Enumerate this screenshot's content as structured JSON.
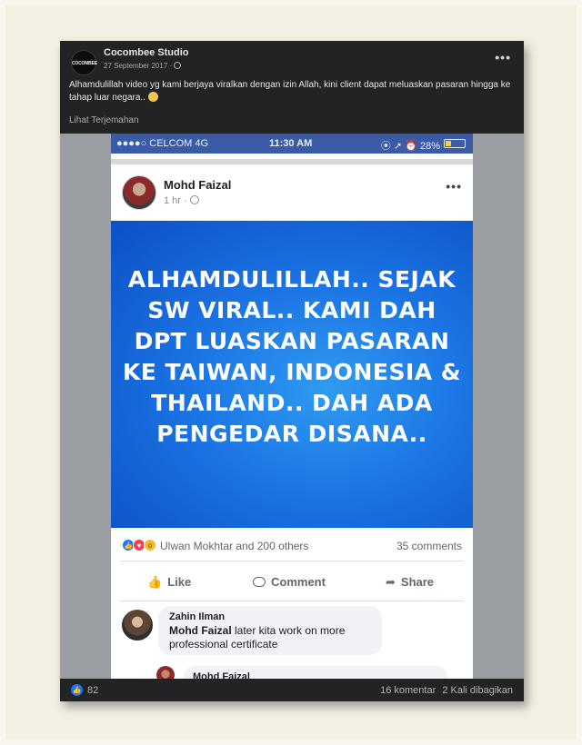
{
  "post": {
    "page_name": "Cocombee Studio",
    "logo_text": "COCOMBEE",
    "date": "27 September 2017 ·",
    "caption": "Alhamdulillah video yg kami berjaya viralkan dengan izin Allah, kini client dapat meluaskan pasaran hingga ke tahap luar negara..",
    "see_translation": "Lihat Terjemahan",
    "more_icon": "more-options-icon"
  },
  "phone": {
    "carrier": "●●●●○ CELCOM  4G",
    "time": "11:30 AM",
    "status_right": "⦿ ➚ ⏰ 28%",
    "battery_percent": 28,
    "poster_name": "Mohd Faizal",
    "poster_time": "1 hr ·",
    "banner_text": "ALHAMDULILLAH.. SEJAK SW VIRAL.. KAMI DAH DPT LUASKAN PASARAN KE TAIWAN, INDONESIA & THAILAND.. DAH ADA PENGEDAR DISANA..",
    "reactions_text": "Ulwan Mokhtar and 200 others",
    "comments_count": "35 comments",
    "actions": {
      "like": "Like",
      "comment": "Comment",
      "share": "Share"
    },
    "comment": {
      "author": "Zahin Ilman",
      "mention": "Mohd Faizal",
      "text": " later kita work on more professional certificate"
    },
    "reply_author": "Mohd Faizal"
  },
  "footer": {
    "like_count": "82",
    "comments": "16 komentar",
    "shares": "2 Kali dibagikan"
  }
}
